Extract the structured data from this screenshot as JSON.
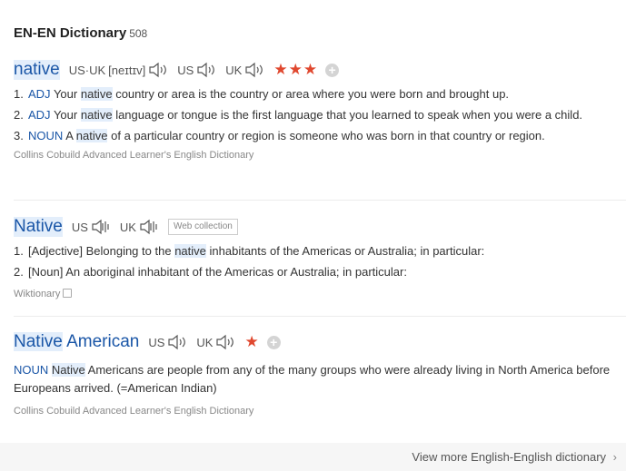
{
  "header": {
    "title": "EN-EN Dictionary",
    "count": "508"
  },
  "entries": [
    {
      "headword": "native",
      "pron1": {
        "label": "US·UK",
        "ipa": "[neɪtɪv]"
      },
      "pron2": "US",
      "pron3": "UK",
      "stars": "★★★",
      "defs": [
        {
          "num": "1.",
          "pos": "ADJ",
          "pre": "Your",
          "hl": "native",
          "post": "country or area is the country or area where you were born and brought up."
        },
        {
          "num": "2.",
          "pos": "ADJ",
          "pre": "Your",
          "hl": "native",
          "post": "language or tongue is the first language that you learned to speak when you were a child."
        },
        {
          "num": "3.",
          "pos": "NOUN",
          "pre": "A",
          "hl": "native",
          "post": "of a particular country or region is someone who was born in that country or region."
        }
      ],
      "source": "Collins Cobuild Advanced Learner's English Dictionary"
    },
    {
      "headword": "Native",
      "pron1": "US",
      "pron2": "UK",
      "tag": "Web collection",
      "defs": [
        {
          "num": "1.",
          "pre": "[Adjective] Belonging to the",
          "hl": "native",
          "post": "inhabitants of the Americas or Australia; in particular:"
        },
        {
          "num": "2.",
          "text": "[Noun] An aboriginal inhabitant of the Americas or Australia; in particular:"
        }
      ],
      "source": "Wiktionary"
    },
    {
      "headword_hl": "Native",
      "headword_rest": " American",
      "pron1": "US",
      "pron2": "UK",
      "stars": "★",
      "def": {
        "pos": "NOUN",
        "hl": "Native",
        "post": "Americans are people from any of the many groups who were already living in North America before Europeans arrived. (=American Indian)"
      },
      "source": "Collins Cobuild Advanced Learner's English Dictionary"
    }
  ],
  "footer": {
    "more_label": "View more English-English dictionary",
    "arrow": "›"
  },
  "icons": {
    "speaker": "speaker-icon",
    "add": "add-icon",
    "copy": "copy-icon",
    "chevron": "chevron-right-icon"
  }
}
